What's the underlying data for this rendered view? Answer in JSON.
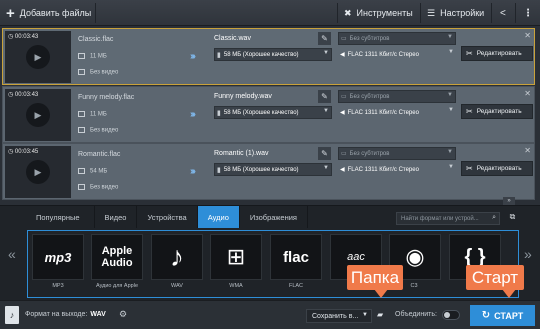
{
  "toolbar": {
    "add_files_label": "Добавить файлы",
    "tools_label": "Инструменты",
    "settings_label": "Настройки"
  },
  "files": [
    {
      "duration": "00:03:43",
      "source_name": "Classic.flac",
      "source_size": "11 МБ",
      "source_video": "Без видео",
      "output_name": "Classic.wav",
      "quality": "58 МБ (Хорошее качество)",
      "subtitles": "Без субтитров",
      "audio": "FLAC 1311 Кбит/с Стерео",
      "edit_label": "Редактировать",
      "selected": true
    },
    {
      "duration": "00:03:43",
      "source_name": "Funny melody.flac",
      "source_size": "11 МБ",
      "source_video": "Без видео",
      "output_name": "Funny melody.wav",
      "quality": "58 МБ (Хорошее качество)",
      "subtitles": "Без субтитров",
      "audio": "FLAC 1311 Кбит/с Стерео",
      "edit_label": "Редактировать",
      "selected": false
    },
    {
      "duration": "00:03:45",
      "source_name": "Romantic.flac",
      "source_size": "54 МБ",
      "source_video": "Без видео",
      "output_name": "Romantic (1).wav",
      "quality": "58 МБ (Хорошее качество)",
      "subtitles": "Без субтитров",
      "audio": "FLAC 1311 Кбит/с Стерео",
      "edit_label": "Редактировать",
      "selected": false
    }
  ],
  "format_tabs": [
    "Популярные",
    "Видео",
    "Устройства",
    "Аудио",
    "Изображения"
  ],
  "active_tab": "Аудио",
  "search": {
    "placeholder": "Найти формат или устрой..."
  },
  "format_tiles": [
    {
      "icon": "mp3",
      "label": "MP3"
    },
    {
      "icon": "Apple Audio",
      "label": "Аудио для Apple"
    },
    {
      "icon": "wav-note",
      "label": "WAV"
    },
    {
      "icon": "windows",
      "label": "WMA"
    },
    {
      "icon": "flac",
      "label": "FLAC"
    },
    {
      "icon": "aac",
      "label": ""
    },
    {
      "icon": "ogg",
      "label": ""
    },
    {
      "icon": "braces",
      "label": ""
    }
  ],
  "bottom": {
    "output_format_label": "Формат на выходе:",
    "output_format_value": "WAV",
    "save_in_label": "Сохранить в...",
    "merge_label": "Объединить:",
    "start_label": "СТАРТ"
  },
  "callouts": {
    "folder": "Папка",
    "start": "Старт"
  },
  "colors": {
    "accent": "#2e8ed8",
    "callout": "#f07a4a",
    "selected_border": "#c9a23a"
  }
}
